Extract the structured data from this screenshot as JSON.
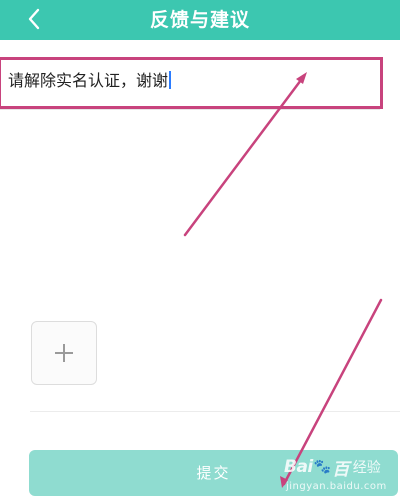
{
  "header": {
    "title": "反馈与建议",
    "back_icon": "chevron-left-icon",
    "background_color": "#3cc7b0"
  },
  "feedback": {
    "text": "请解除实名认证，谢谢"
  },
  "attachment": {
    "add_icon": "plus-icon"
  },
  "submit": {
    "label": "提交",
    "background_color": "#8fdcd0"
  },
  "annotation": {
    "color": "#c8437d"
  },
  "watermark": {
    "brand": "Bai",
    "brand_suffix": "百",
    "paw_symbol": "🐾",
    "label": "经验",
    "url": "jingyan.baidu.com"
  }
}
